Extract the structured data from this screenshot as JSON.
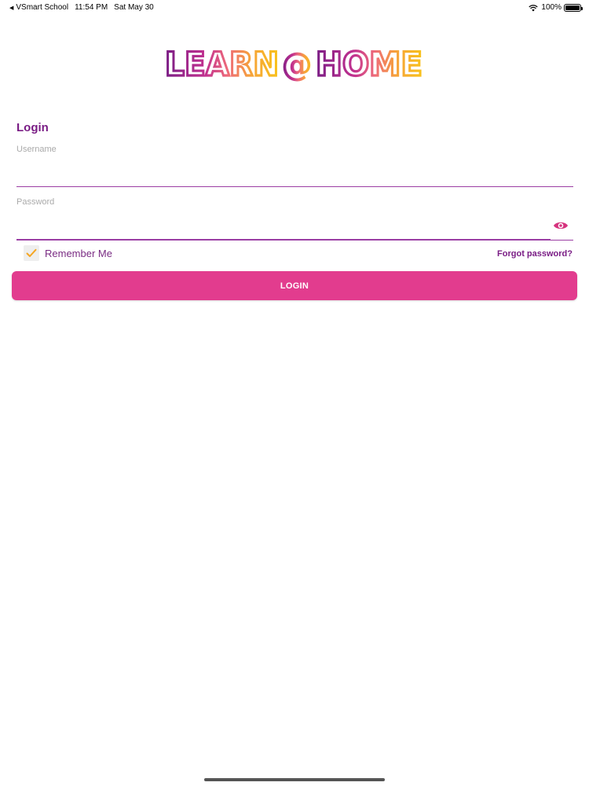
{
  "status_bar": {
    "back_arrow": "◀",
    "app": "VSmart School",
    "time": "11:54 PM",
    "date": "Sat May 30",
    "battery": "100%",
    "battery_level": 1.0
  },
  "logo": {
    "left_text": "LEARN",
    "at_text": "@",
    "right_text": "HOME"
  },
  "colors": {
    "brand_purple": "#7a1d85",
    "accent_pink": "#e23c8e",
    "logo_yellow": "#f8c21a",
    "check_yellow": "#f5a623"
  },
  "form": {
    "title": "Login",
    "username": {
      "label": "Username",
      "value": ""
    },
    "password": {
      "label": "Password",
      "value": ""
    },
    "remember_label": "Remember Me",
    "remember_checked": true,
    "forgot_label": "Forgot password?",
    "login_label": "LOGIN"
  },
  "icons": {
    "eye": "eye-icon",
    "check": "checkmark-icon",
    "wifi": "wifi-icon",
    "battery": "battery-icon"
  }
}
